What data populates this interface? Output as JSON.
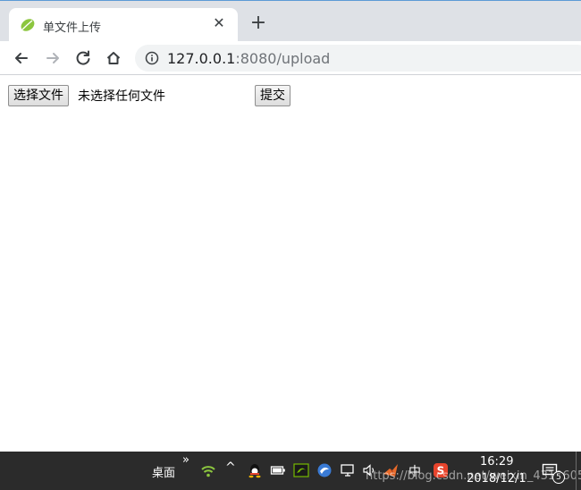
{
  "tab": {
    "title": "单文件上传",
    "close_glyph": "✕",
    "new_tab_glyph": "+",
    "favicon": "spring-leaf-icon"
  },
  "toolbar": {
    "back_icon": "back-arrow-icon",
    "forward_icon": "forward-arrow-icon",
    "reload_icon": "reload-icon",
    "home_icon": "home-icon",
    "info_icon": "info-icon",
    "url_host": "127.0.0.1",
    "url_rest": ":8080/upload"
  },
  "form": {
    "choose_file_label": "选择文件",
    "file_status": "未选择任何文件",
    "submit_label": "提交"
  },
  "taskbar": {
    "desktop_label": "桌面",
    "overflow_glyph": "»",
    "tray_chevron": "^",
    "ime_label": "中",
    "time": "16:29",
    "date": "2018/12/1",
    "notification_count": "5",
    "watermark": "https://blog.csdn.net/weixin_43106056",
    "colors": {
      "background": "#2b2b2b",
      "wifi": "#8cc63f",
      "nvidia": "#76b900",
      "sogou": "#e8442c"
    }
  }
}
